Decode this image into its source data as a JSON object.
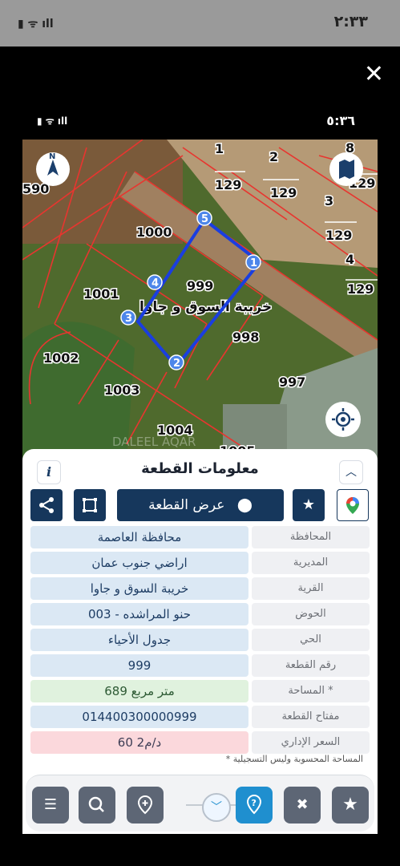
{
  "outer_status": {
    "time": "٢:٣٣",
    "icons": "▮ ᯤ ıll"
  },
  "inner_status": {
    "time": "٥:٣٦",
    "icons": "▮ ᯤ ıll"
  },
  "map": {
    "parcel_labels": [
      "1000",
      "999",
      "1001",
      "998",
      "1002",
      "1003",
      "997",
      "1004",
      "1005",
      "590"
    ],
    "village_label": "خريبة السوق و جاوا",
    "vertex_labels": [
      "1",
      "2",
      "3",
      "4",
      "5"
    ],
    "block_numbers": [
      "1",
      "2",
      "3",
      "4",
      "8"
    ],
    "block_value": "129",
    "watermark": "DALEEL AQAR",
    "highlight_color": "#1a3ee0",
    "parcel_line_color": "#e8352f"
  },
  "panel": {
    "title": "معلومات القطعة",
    "info_icon": "i",
    "view_button_label": "عرض القطعة",
    "rows": [
      {
        "label": "المحافظة",
        "value": "محافظة العاصمة",
        "style": "blue"
      },
      {
        "label": "المديرية",
        "value": "اراضي جنوب عمان",
        "style": "blue"
      },
      {
        "label": "القرية",
        "value": "خريبة السوق  و جاوا",
        "style": "blue"
      },
      {
        "label": "الحوض",
        "value": "حنو المراشده - 003",
        "style": "blue"
      },
      {
        "label": "الحي",
        "value": "جدول الأحياء",
        "style": "blue"
      },
      {
        "label": "رقم القطعة",
        "value": "999",
        "style": "blue"
      },
      {
        "label": "المساحة *",
        "value": "689  متر مربع",
        "style": "green"
      },
      {
        "label": "مفتاح القطعة",
        "value": "014400300000999",
        "style": "blue"
      },
      {
        "label": "السعر الإداري",
        "value": "60 د/م2",
        "style": "pink"
      }
    ],
    "note": "* المساحة المحسوبة وليس التسجيلية"
  },
  "icons": {
    "close": "close-icon",
    "compass": "compass-icon",
    "map_layers": "map-icon",
    "location": "locate-icon",
    "share": "share-icon",
    "polygon": "polygon-icon",
    "pin": "location-pin-icon",
    "star": "star-icon",
    "google_maps": "google-maps-icon",
    "list": "list-icon",
    "search": "search-icon",
    "place": "place-icon",
    "chevron": "chevron-down-icon",
    "help": "help-icon",
    "tools": "tools-icon"
  }
}
